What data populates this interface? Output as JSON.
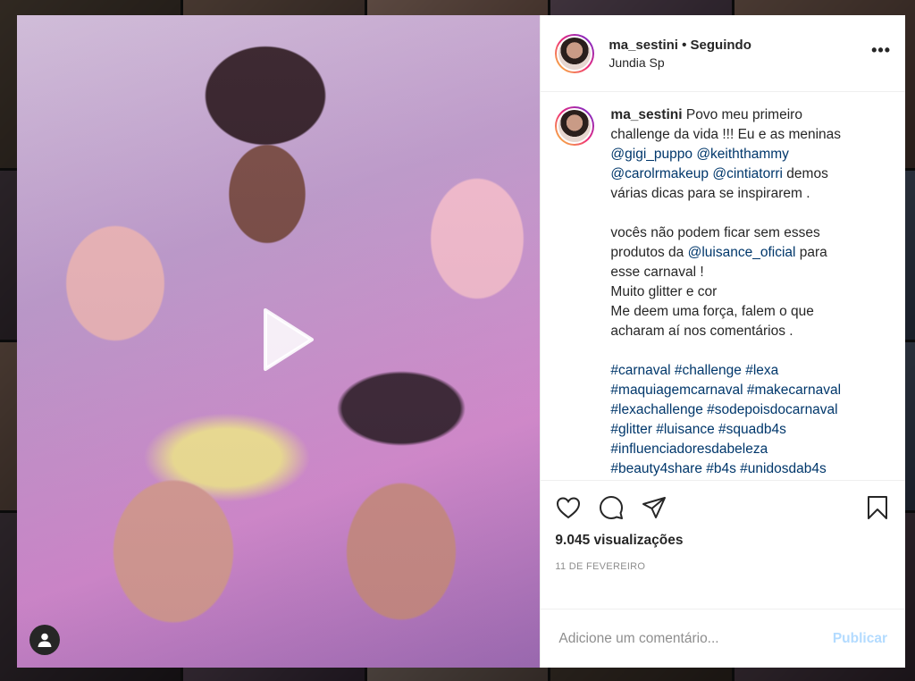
{
  "header": {
    "username": "ma_sestini",
    "separator": " • ",
    "follow_status": "Seguindo",
    "location": "Jundia Sp"
  },
  "caption": {
    "username": "ma_sestini",
    "lines": [
      "Povo meu primeiro",
      "challenge da vida !!! Eu e as meninas",
      "@gigi_puppo @keiththammy",
      "@carolrmakeup @cintiatorri demos",
      "várias dicas para se inspirarem .",
      "vocês não podem ficar sem esses",
      "produtos da @luisance_oficial para",
      "esse carnaval !",
      "Muito glitter e cor",
      "Me deem uma força, falem o que",
      "acharam aí nos comentários .",
      "#carnaval #challenge #lexa",
      "#maquiagemcarnaval #makecarnaval",
      "#lexachallenge #sodepoisdocarnaval",
      "#glitter #luisance #squadb4s",
      "#influenciadoresdabeleza",
      "#beauty4share #b4s #unidosdab4s"
    ],
    "mentions": {
      "m1": "@gigi_puppo",
      "m2": "@keiththammy",
      "m3": "@carolrmakeup",
      "m4": "@cintiatorri",
      "m5": "@luisance_oficial"
    },
    "text": {
      "t1": "Povo meu primeiro",
      "t2": "challenge da vida !!! Eu e as meninas",
      "t3": "demos",
      "t4": "várias dicas para se inspirarem .",
      "t5": "vocês não podem ficar sem esses",
      "t6": "produtos da",
      "t7": "para",
      "t8": "esse carnaval !",
      "t9": "Muito glitter e cor",
      "t10": "Me deem uma força, falem o que",
      "t11": "acharam aí nos comentários ."
    },
    "hashtags": [
      "#carnaval #challenge #lexa",
      "#maquiagemcarnaval #makecarnaval",
      "#lexachallenge #sodepoisdocarnaval",
      "#glitter #luisance #squadb4s",
      "#influenciadoresdabeleza",
      "#beauty4share #b4s #unidosdab4s"
    ]
  },
  "stats": {
    "views": "9.045 visualizações",
    "date": "11 DE FEVEREIRO"
  },
  "comment_box": {
    "placeholder": "Adicione um comentário...",
    "post_label": "Publicar"
  },
  "icons": {
    "like": "heart-icon",
    "comment": "comment-icon",
    "share": "share-icon",
    "save": "bookmark-icon",
    "more": "more-options-icon",
    "play": "play-icon",
    "tagged": "user-icon"
  },
  "colors": {
    "link": "#00376b",
    "post_disabled": "#b3dbff",
    "muted": "#8e8e8e",
    "text": "#262626"
  }
}
